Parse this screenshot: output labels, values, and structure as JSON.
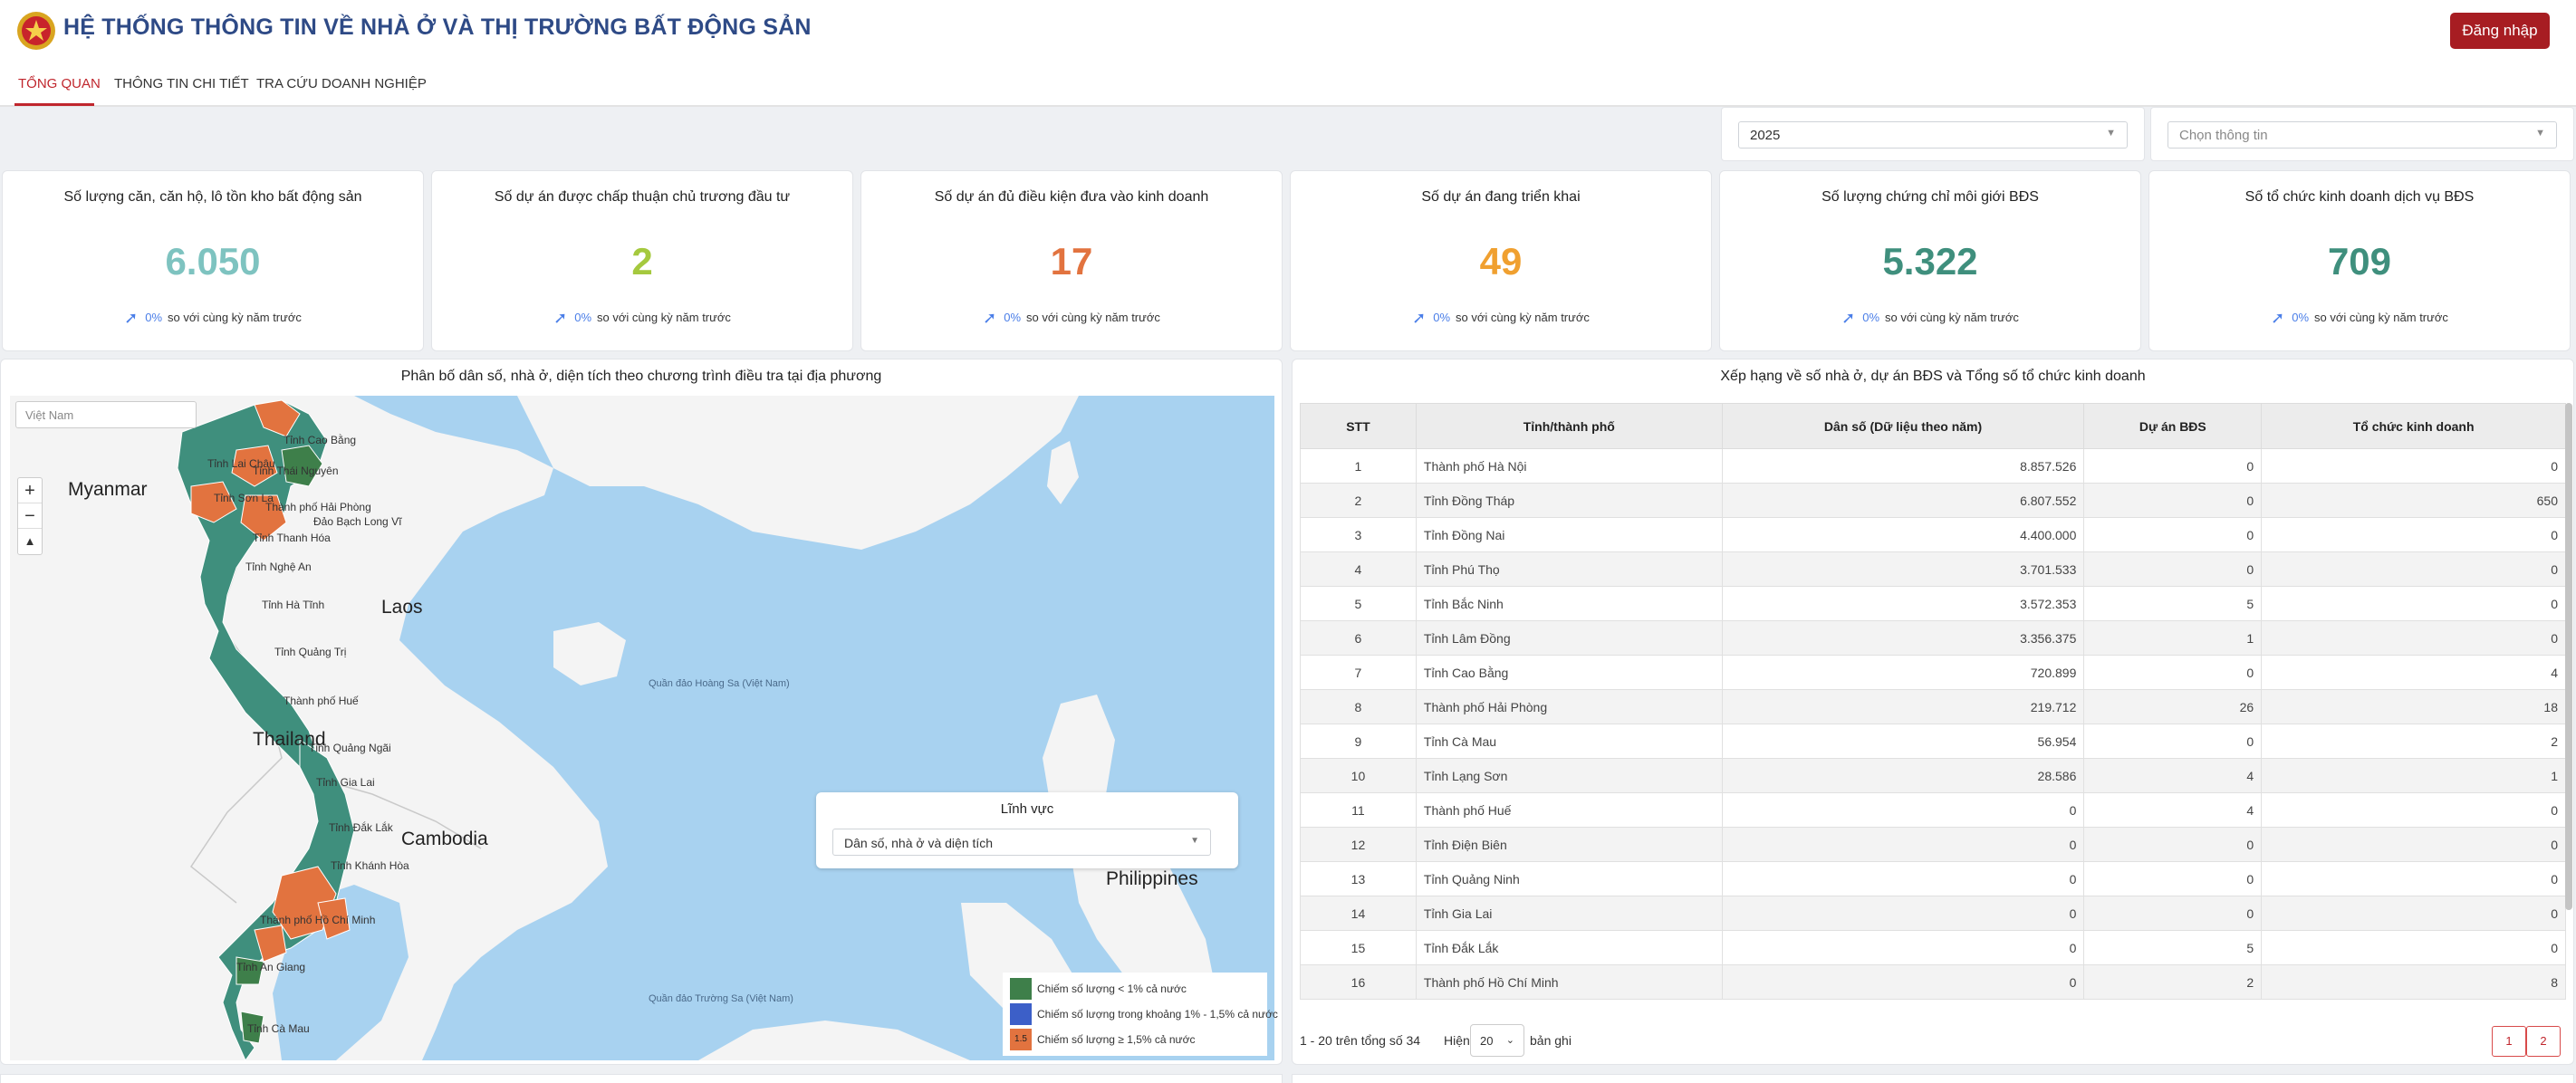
{
  "header": {
    "title": "HỆ THỐNG THÔNG TIN VỀ NHÀ Ở VÀ THỊ TRƯỜNG BẤT ĐỘNG SẢN",
    "login_label": "Đăng nhập",
    "logo_icon": "national-emblem-icon"
  },
  "tabs": [
    {
      "label": "TỔNG QUAN",
      "active": true
    },
    {
      "label": "THÔNG TIN CHI TIẾT",
      "active": false
    },
    {
      "label": "TRA CỨU DOANH NGHIỆP",
      "active": false
    }
  ],
  "filters": {
    "year": "2025",
    "info_placeholder": "Chọn thông tin"
  },
  "stats": [
    {
      "title": "Số lượng căn, căn hộ, lô tồn kho bất động sản",
      "value": "6.050",
      "color": "#7ec3c0",
      "pct": "0%",
      "note": "so với cùng kỳ năm trước"
    },
    {
      "title": "Số dự án được chấp thuận chủ trương đầu tư",
      "value": "2",
      "color": "#a5c93e",
      "pct": "0%",
      "note": "so với cùng kỳ năm trước"
    },
    {
      "title": "Số dự án đủ điều kiện đưa vào kinh doanh",
      "value": "17",
      "color": "#e2733f",
      "pct": "0%",
      "note": "so với cùng kỳ năm trước"
    },
    {
      "title": "Số dự án đang triển khai",
      "value": "49",
      "color": "#f0a030",
      "pct": "0%",
      "note": "so với cùng kỳ năm trước"
    },
    {
      "title": "Số lượng chứng chỉ môi giới BĐS",
      "value": "5.322",
      "color": "#3f8f7d",
      "pct": "0%",
      "note": "so với cùng kỳ năm trước"
    },
    {
      "title": "Số tổ chức kinh doanh dịch vụ BĐS",
      "value": "709",
      "color": "#3f8f7d",
      "pct": "0%",
      "note": "so với cùng kỳ năm trước"
    }
  ],
  "map_panel": {
    "title": "Phân bố dân số, nhà ở, diện tích theo chương trình điều tra tại địa phương",
    "region_select": "Việt Nam",
    "field_label": "Lĩnh vực",
    "field_value": "Dân số, nhà ở và diện tích",
    "countries": [
      "Myanmar",
      "Laos",
      "Thailand",
      "Cambodia",
      "Philippines"
    ],
    "provinces": [
      "Tỉnh Cao Bằng",
      "Tỉnh Lai Châu",
      "Tỉnh Thái Nguyên",
      "Tỉnh Sơn La",
      "Thành phố Hải Phòng",
      "Đảo Bạch Long Vĩ",
      "Tỉnh Thanh Hóa",
      "Tỉnh Nghệ An",
      "Tỉnh Hà Tĩnh",
      "Tỉnh Quảng Trị",
      "Thành phố Huế",
      "Tỉnh Quảng Ngãi",
      "Tỉnh Gia Lai",
      "Tỉnh Đắk Lắk",
      "Tỉnh Khánh Hòa",
      "Thành phố Hồ Chí Minh",
      "Tỉnh An Giang",
      "Tỉnh Cà Mau"
    ],
    "seas": [
      "Quần đảo Hoàng Sa (Việt Nam)",
      "Quần đảo Trường Sa (Việt Nam)"
    ],
    "legend": [
      {
        "text": "Chiếm số lượng < 1% cả nước",
        "color": "#3e7f4a",
        "tag": ""
      },
      {
        "text": "Chiếm số lượng trong khoảng 1% - 1,5% cả nước",
        "color": "#3c5fc8",
        "tag": ""
      },
      {
        "text": "Chiếm số lượng ≥ 1,5% cả nước",
        "color": "#e2733f",
        "tag": "1.5"
      }
    ],
    "colors": {
      "teal": "#3f8f7d",
      "green": "#3e7f4a",
      "orange": "#e2733f",
      "land": "#f4f4f4",
      "sea": "#a8d2f0"
    }
  },
  "table_panel": {
    "title": "Xếp hạng về số nhà ở, dự án BĐS và Tổng số tổ chức kinh doanh",
    "headers": [
      "STT",
      "Tỉnh/thành phố",
      "Dân số (Dữ liệu theo năm)",
      "Dự án BĐS",
      "Tổ chức kinh doanh"
    ],
    "rows": [
      [
        "1",
        "Thành phố Hà Nội",
        "8.857.526",
        "0",
        "0"
      ],
      [
        "2",
        "Tỉnh Đồng Tháp",
        "6.807.552",
        "0",
        "650"
      ],
      [
        "3",
        "Tỉnh Đồng Nai",
        "4.400.000",
        "0",
        "0"
      ],
      [
        "4",
        "Tỉnh Phú Thọ",
        "3.701.533",
        "0",
        "0"
      ],
      [
        "5",
        "Tỉnh Bắc Ninh",
        "3.572.353",
        "5",
        "0"
      ],
      [
        "6",
        "Tỉnh Lâm Đồng",
        "3.356.375",
        "1",
        "0"
      ],
      [
        "7",
        "Tỉnh Cao Bằng",
        "720.899",
        "0",
        "4"
      ],
      [
        "8",
        "Thành phố Hải Phòng",
        "219.712",
        "26",
        "18"
      ],
      [
        "9",
        "Tỉnh Cà Mau",
        "56.954",
        "0",
        "2"
      ],
      [
        "10",
        "Tỉnh Lạng Sơn",
        "28.586",
        "4",
        "1"
      ],
      [
        "11",
        "Thành phố Huế",
        "0",
        "4",
        "0"
      ],
      [
        "12",
        "Tỉnh Điện Biên",
        "0",
        "0",
        "0"
      ],
      [
        "13",
        "Tỉnh Quảng Ninh",
        "0",
        "0",
        "0"
      ],
      [
        "14",
        "Tỉnh Gia Lai",
        "0",
        "0",
        "0"
      ],
      [
        "15",
        "Tỉnh Đắk Lắk",
        "0",
        "5",
        "0"
      ],
      [
        "16",
        "Thành phố Hồ Chí Minh",
        "0",
        "2",
        "8"
      ]
    ],
    "pager_text": "1 - 20 trên tổng số 34",
    "show_label": "Hiện",
    "page_size": "20",
    "records_label": "bản ghi",
    "pages": [
      "1",
      "2"
    ]
  }
}
